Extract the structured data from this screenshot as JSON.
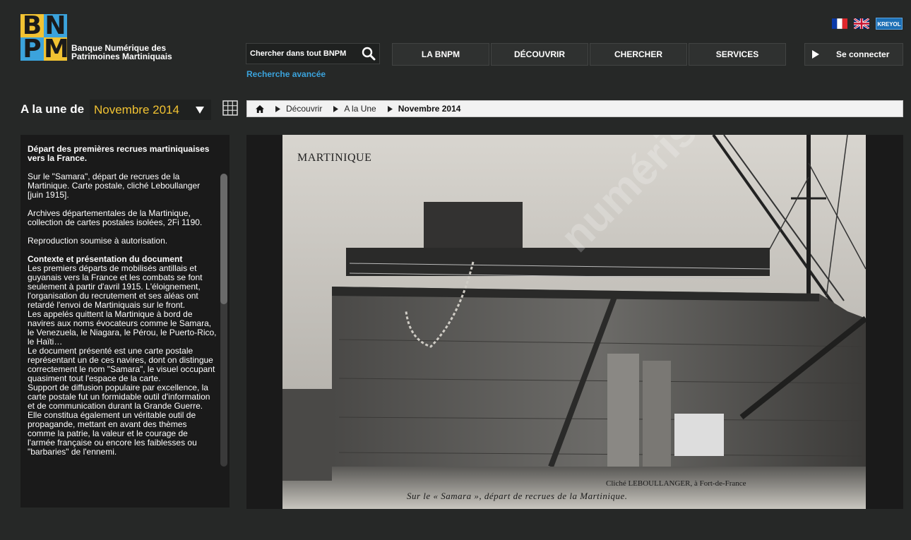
{
  "logo": {
    "letters": [
      "B",
      "N",
      "P",
      "M"
    ],
    "line1": "Banque Numérique des",
    "line2": "Patrimoines Martiniquais"
  },
  "languages": {
    "fr_icon": "flag-fr-icon",
    "en_icon": "flag-uk-icon",
    "kreyol": "KREYOL"
  },
  "search": {
    "placeholder": "Chercher dans tout BNPM",
    "advanced_label": "Recherche avancée"
  },
  "nav": {
    "items": [
      "LA BNPM",
      "DÉCOUVRIR",
      "CHERCHER",
      "SERVICES"
    ],
    "login": "Se connecter"
  },
  "header": {
    "une_label": "A la une de",
    "month": "Novembre 2014"
  },
  "breadcrumb": {
    "items": [
      "Découvrir",
      "A la Une"
    ],
    "current": "Novembre 2014"
  },
  "description": {
    "title": "Départ des premières recrues martiniquaises vers la France.",
    "p1": "Sur le \"Samara\", départ de recrues de la Martinique. Carte postale, cliché Leboullanger [juin 1915].",
    "p2": "Archives départementales de la Martinique, collection de cartes postales isolées, 2Fi 1190.",
    "p3": "Reproduction soumise à autorisation.",
    "context_title": "Contexte et présentation du document",
    "body1": "Les premiers départs de mobilisés antillais et guyanais vers la France et les combats se font seulement à partir d'avril 1915. L'éloignement, l'organisation du recrutement et ses aléas ont retardé l'envoi de Martiniquais sur le front.",
    "body2": "Les appelés quittent la Martinique à bord de navires aux noms évocateurs comme le Samara, le Venezuela, le Niagara, le Pérou, le Puerto-Rico, le Haïti…",
    "body3": "Le document présenté est une carte postale représentant un de ces navires, dont on distingue correctement le nom \"Samara\", le visuel occupant quasiment tout l'espace de la carte.",
    "body4": "Support de diffusion populaire par excellence, la carte postale fut un formidable outil d'information et de communication durant la Grande Guerre. Elle constitua également un véritable outil de propagande, mettant en avant des thèmes comme la patrie, la valeur et le courage de l'armée française ou encore les faiblesses ou \"barbaries\" de l'ennemi."
  },
  "postcard": {
    "title": "MARTINIQUE",
    "credit": "Cliché LEBOULLANGER, à Fort-de-France",
    "caption": "Sur le « Samara », départ de recrues de la Martinique.",
    "watermark": "numérisé"
  },
  "colors": {
    "background": "#262827",
    "accent_yellow": "#f1c232",
    "accent_blue": "#3ba3dc"
  }
}
